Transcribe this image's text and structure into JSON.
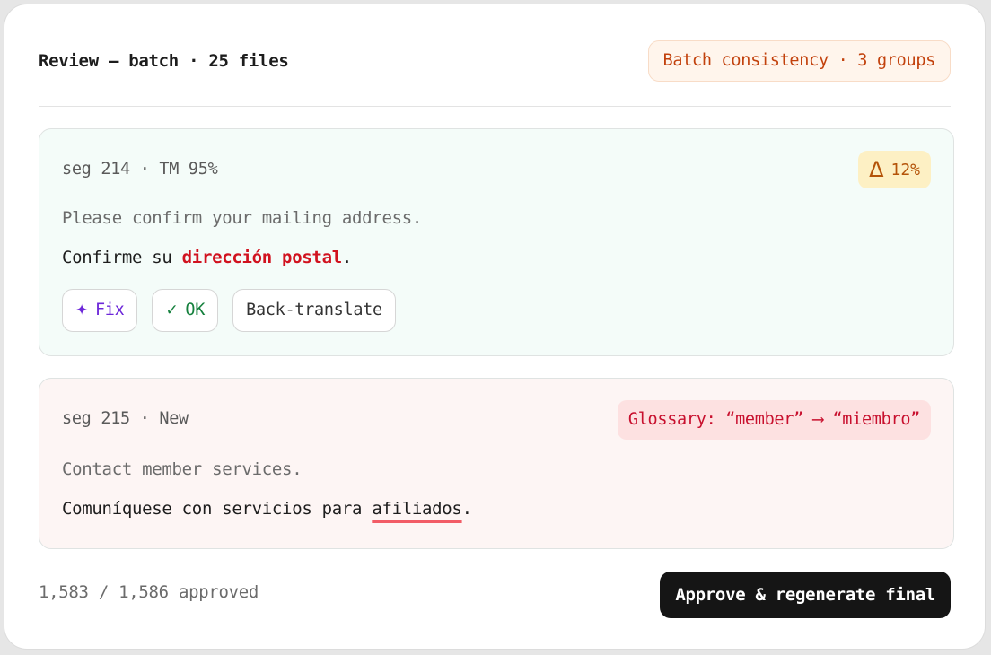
{
  "header": {
    "title": "Review — batch · 25 files",
    "consistency_badge": "Batch consistency · 3 groups"
  },
  "segments": [
    {
      "meta": "seg 214 · TM 95%",
      "badge": {
        "icon": "delta-icon",
        "icon_glyph": "Δ",
        "text": "12%"
      },
      "source": "Please confirm your mailing address.",
      "target_before": "Confirme su ",
      "target_highlight": "dirección postal",
      "target_after": ".",
      "actions": [
        {
          "icon": "sparkle-icon",
          "glyph": "✦",
          "label": "Fix"
        },
        {
          "icon": "check-icon",
          "glyph": "✓",
          "label": "OK"
        },
        {
          "label": "Back-translate"
        }
      ]
    },
    {
      "meta": "seg 215 · New",
      "glossary_badge": "Glossary: “member” ⟶ “miembro”",
      "source": "Contact member services.",
      "target_before": "Comuníquese con servicios para ",
      "target_flagged": "afiliados",
      "target_after": "."
    }
  ],
  "footer": {
    "approved_count": "1,583 / 1,586 approved",
    "approve_button": "Approve & regenerate final"
  },
  "colors": {
    "accent_warning": "#c2410c",
    "accent_error": "#d1121f",
    "accent_fix": "#6d28d9",
    "accent_ok": "#15803d",
    "primary_button": "#151515"
  }
}
